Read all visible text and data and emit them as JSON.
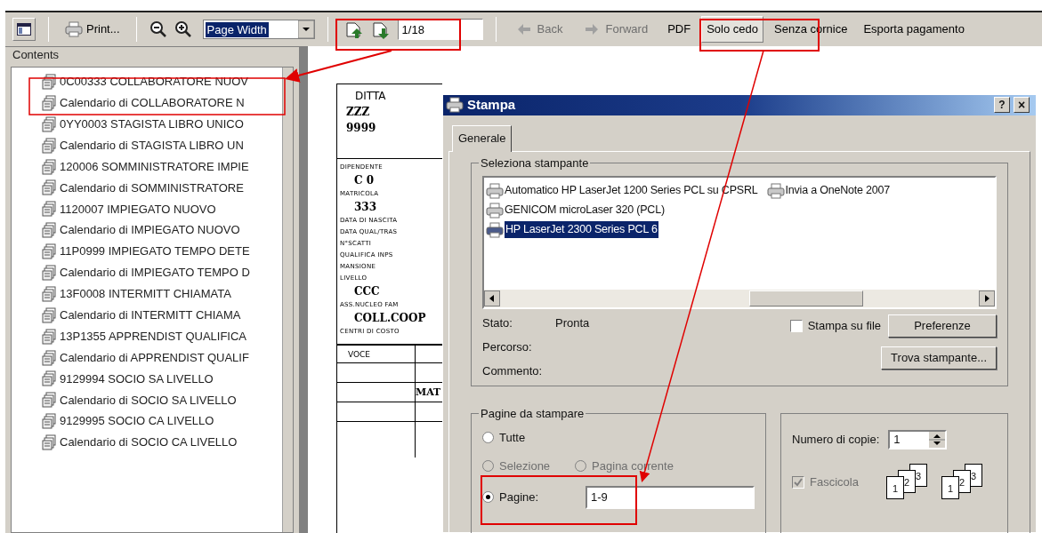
{
  "toolbar": {
    "print": "Print...",
    "zoom_select": "Page Width",
    "page_field": "1/18",
    "nav": [
      {
        "label": "Back",
        "disabled": true
      },
      {
        "label": "Forward",
        "disabled": true
      }
    ],
    "actions": [
      {
        "label": "PDF",
        "pressed": false
      },
      {
        "label": "Solo cedo",
        "pressed": true
      },
      {
        "label": "Senza cornice",
        "pressed": false
      },
      {
        "label": "Esporta pagamento",
        "pressed": false
      }
    ]
  },
  "contents": {
    "title": "Contents",
    "items": [
      {
        "label": "0C00333 COLLABORATORE NUOV"
      },
      {
        "label": "Calendario di COLLABORATORE N"
      },
      {
        "label": "0YY0003 STAGISTA LIBRO UNICO"
      },
      {
        "label": "Calendario di STAGISTA LIBRO UN"
      },
      {
        "label": "120006 SOMMINISTRATORE IMPIE"
      },
      {
        "label": "Calendario di SOMMINISTRATORE"
      },
      {
        "label": "1120007 IMPIEGATO NUOVO"
      },
      {
        "label": "Calendario di IMPIEGATO NUOVO"
      },
      {
        "label": "11P0999 IMPIEGATO TEMPO DETE"
      },
      {
        "label": "Calendario di IMPIEGATO TEMPO D"
      },
      {
        "label": "13F0008 INTERMITT CHIAMATA"
      },
      {
        "label": "Calendario di INTERMITT CHIAMA"
      },
      {
        "label": "13P1355 APPRENDIST QUALIFICA"
      },
      {
        "label": "Calendario di APPRENDIST QUALIF"
      },
      {
        "label": "9129994 SOCIO SA LIVELLO"
      },
      {
        "label": "Calendario di SOCIO SA LIVELLO"
      },
      {
        "label": "9129995 SOCIO CA LIVELLO"
      },
      {
        "label": "Calendario di SOCIO CA LIVELLO"
      }
    ]
  },
  "document": {
    "header": [
      "DITTA",
      "ZZZ",
      "9999"
    ],
    "lines": [
      {
        "text": "DIPENDENTE",
        "kind": "label"
      },
      {
        "text": "C 0",
        "kind": "value"
      },
      {
        "text": "MATRICOLA",
        "kind": "label"
      },
      {
        "text": "333",
        "kind": "value"
      },
      {
        "text": "DATA DI NASCITA",
        "kind": "label"
      },
      {
        "text": "DATA QUAL/TRAS",
        "kind": "label"
      },
      {
        "text": "N°SCATTI",
        "kind": "label"
      },
      {
        "text": "QUALIFICA INPS",
        "kind": "label"
      },
      {
        "text": "MANSIONE",
        "kind": "label"
      },
      {
        "text": "LIVELLO",
        "kind": "label"
      },
      {
        "text": "CCC",
        "kind": "value"
      },
      {
        "text": "ASS.NUCLEO FAM",
        "kind": "label"
      },
      {
        "text": "COLL.COOP",
        "kind": "value"
      },
      {
        "text": "CENTRI DI COSTO",
        "kind": "label"
      }
    ],
    "table": {
      "column_1": "VOCE",
      "cell": "MAT"
    }
  },
  "dialog": {
    "title": "Stampa",
    "help": "?",
    "close": "×",
    "tabs": [
      {
        "label": "Generale",
        "selected": true
      }
    ],
    "printer_group": {
      "title": "Seleziona stampante",
      "printers": [
        {
          "label": "Automatico HP LaserJet 1200 Series PCL su CPSRL",
          "selected": false
        },
        {
          "label": "Invia a OneNote 2007",
          "selected": false
        },
        {
          "label": "GENICOM microLaser 320 (PCL)",
          "selected": false
        },
        {
          "label": "HP LaserJet 2300 Series PCL 6",
          "selected": true
        }
      ],
      "info": [
        {
          "label": "Stato:",
          "value": "Pronta"
        },
        {
          "label": "Percorso:"
        },
        {
          "label": "Commento:"
        }
      ],
      "print_to_file": {
        "label": "Stampa su file",
        "checked": false
      },
      "buttons": [
        "Preferenze",
        "Trova stampante..."
      ]
    },
    "pages_group": {
      "title": "Pagine da stampare",
      "options": [
        {
          "label": "Tutte",
          "selected": false,
          "disabled": false
        },
        {
          "label": "Selezione",
          "selected": false,
          "disabled": true
        },
        {
          "label": "Pagina corrente",
          "selected": false,
          "disabled": true
        },
        {
          "label": "Pagine:",
          "selected": true,
          "disabled": false
        }
      ],
      "pages_value": "1-9"
    },
    "copies_group": {
      "label": "Numero di copie:",
      "value": "1",
      "collate": {
        "label": "Fascicola",
        "checked": true,
        "disabled": true
      },
      "collate_icons": [
        [
          "1",
          "2",
          "3"
        ],
        [
          "1",
          "2",
          "3"
        ]
      ]
    }
  }
}
